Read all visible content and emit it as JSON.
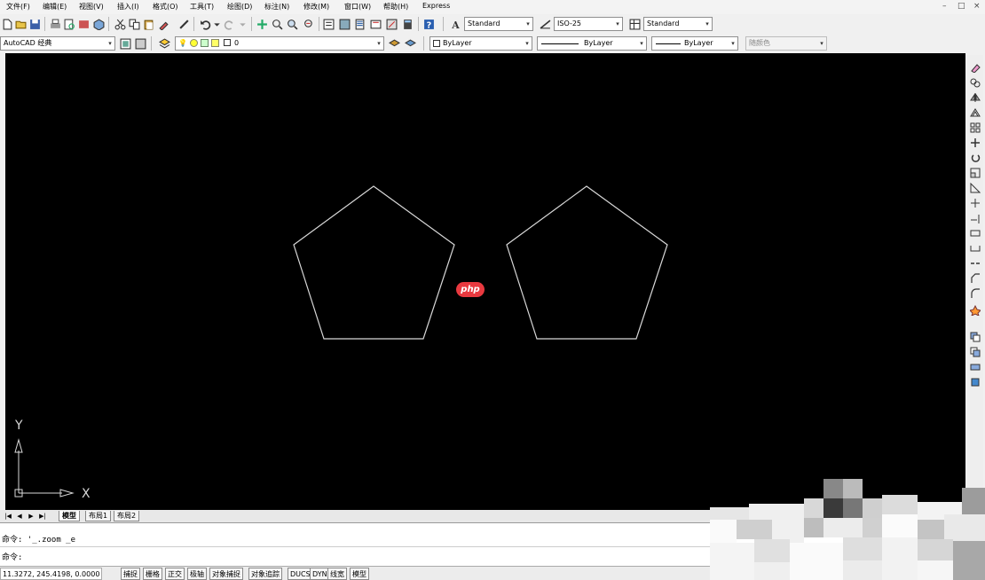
{
  "menubar": {
    "items": [
      "文件(F)",
      "编辑(E)",
      "视图(V)",
      "插入(I)",
      "格式(O)",
      "工具(T)",
      "绘图(D)",
      "标注(N)",
      "修改(M)",
      "窗口(W)",
      "帮助(H)",
      "Express"
    ],
    "window_controls": [
      "–",
      "□",
      "×"
    ]
  },
  "toolbar": {
    "text_style": "Standard",
    "dim_style": "ISO-25",
    "table_style": "Standard",
    "workspace": "AutoCAD 经典",
    "layer": "0",
    "color": "ByLayer",
    "linetype": "ByLayer",
    "lineweight": "ByLayer",
    "plot_style": "随颜色"
  },
  "canvas": {
    "ucs_x_label": "X",
    "ucs_y_label": "Y",
    "watermark": "php"
  },
  "tabs": {
    "items": [
      "模型",
      "布局1",
      "布局2"
    ],
    "active": 0
  },
  "command": {
    "history_line": "命令: '_.zoom _e",
    "prompt_line": "命令:"
  },
  "status_bar": {
    "coordinates": "11.3272, 245.4198, 0.0000",
    "toggles": [
      "捕捉",
      "栅格",
      "正交",
      "极轴",
      "对象捕捉",
      "对象追踪",
      "DUCS",
      "DYN",
      "线宽",
      "模型"
    ]
  },
  "colors": {
    "canvas_background": "#000000",
    "geometry_stroke": "#d8d8d8",
    "watermark_badge": "#e8393f"
  }
}
